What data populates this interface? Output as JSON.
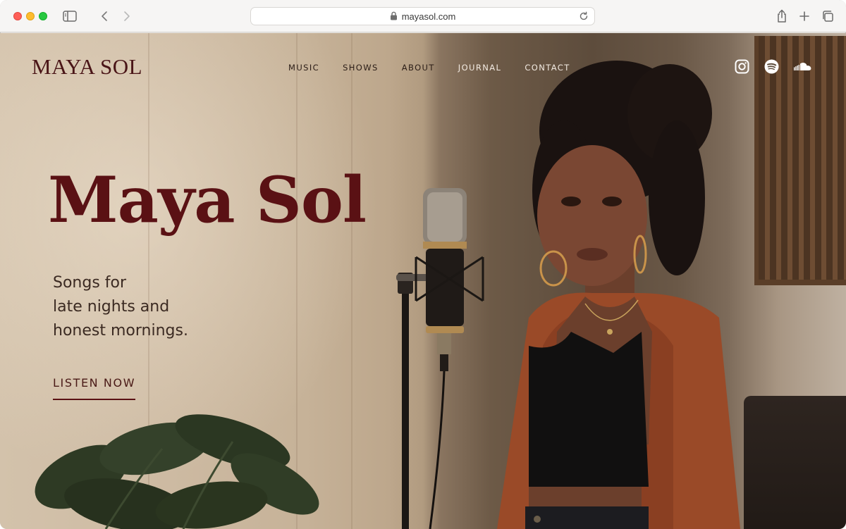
{
  "browser": {
    "url": "mayasol.com"
  },
  "site": {
    "logo": "MAYA SOL",
    "nav": [
      "MUSIC",
      "SHOWS",
      "ABOUT",
      "JOURNAL",
      "CONTACT"
    ],
    "social": [
      "instagram-icon",
      "spotify-icon",
      "soundcloud-icon"
    ]
  },
  "hero": {
    "title": "Maya Sol",
    "tagline": [
      "Songs for",
      "late nights and",
      "honest mornings."
    ],
    "cta": "LISTEN NOW"
  },
  "colors": {
    "brand": "#5a1114",
    "text_dark": "#3b2a22"
  }
}
